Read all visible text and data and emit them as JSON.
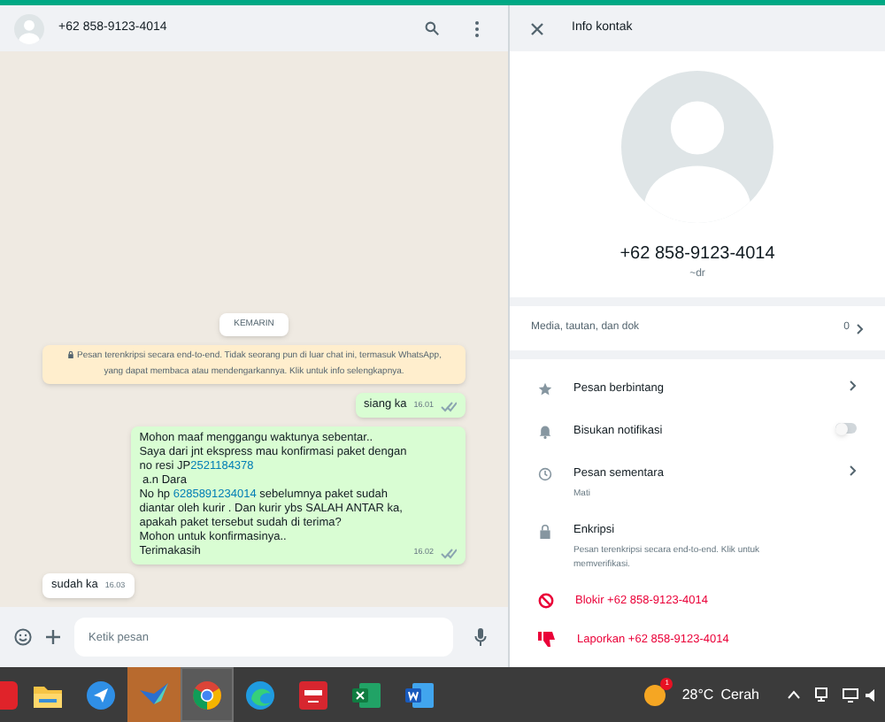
{
  "chat_header": {
    "name": "+62 858-9123-4014"
  },
  "date_chip": "KEMARIN",
  "encryption_notice": "Pesan terenkripsi secara end-to-end. Tidak seorang pun di luar chat ini, termasuk WhatsApp, yang dapat membaca atau mendengarkannya. Klik untuk info selengkapnya.",
  "messages": [
    {
      "outgoing": true,
      "time": "16.01",
      "lines": [
        [
          {
            "text": "siang ka",
            "link": false
          }
        ]
      ]
    },
    {
      "outgoing": true,
      "time": "16.02",
      "lines": [
        [
          {
            "text": "Mohon maaf menggangu waktunya sebentar..",
            "link": false
          }
        ],
        [
          {
            "text": "Saya dari jnt ekspress mau konfirmasi paket dengan",
            "link": false
          }
        ],
        [
          {
            "text": "no resi JP",
            "link": false
          },
          {
            "text": "2521184378",
            "link": true
          }
        ],
        [
          {
            "text": " a.n Dara",
            "link": false
          }
        ],
        [
          {
            "text": "No hp ",
            "link": false
          },
          {
            "text": "6285891234014",
            "link": true
          },
          {
            "text": " sebelumnya paket sudah",
            "link": false
          }
        ],
        [
          {
            "text": "diantar oleh kurir . Dan kurir ybs SALAH ANTAR ka,",
            "link": false
          }
        ],
        [
          {
            "text": "apakah paket tersebut sudah di terima?",
            "link": false
          }
        ],
        [
          {
            "text": "Mohon untuk konfirmasinya..",
            "link": false
          }
        ],
        [
          {
            "text": "Terimakasih",
            "link": false
          }
        ]
      ]
    },
    {
      "outgoing": false,
      "time": "16.03",
      "lines": [
        [
          {
            "text": "sudah ka",
            "link": false
          }
        ]
      ]
    }
  ],
  "composer": {
    "placeholder": "Ketik pesan"
  },
  "info_panel": {
    "title": "Info kontak",
    "phone": "+62 858-9123-4014",
    "about": "~dr",
    "media": {
      "label": "Media, tautan, dan dok",
      "count": "0"
    },
    "items": [
      {
        "kind": "link",
        "label": "Pesan berbintang"
      },
      {
        "kind": "toggle",
        "label": "Bisukan notifikasi",
        "on": false
      },
      {
        "kind": "link",
        "label": "Pesan sementara",
        "sub": "Mati"
      },
      {
        "kind": "info",
        "label": "Enkripsi",
        "sub": "Pesan terenkripsi secara end-to-end. Klik untuk memverifikasi."
      }
    ],
    "actions": [
      {
        "label": "Blokir +62 858-9123-4014"
      },
      {
        "label": "Laporkan +62 858-9123-4014"
      }
    ]
  },
  "taskbar": {
    "apps": [
      {
        "kind": "red",
        "active": false,
        "hover": false
      },
      {
        "kind": "folder",
        "active": false,
        "hover": false
      },
      {
        "kind": "send",
        "active": false,
        "hover": false
      },
      {
        "kind": "bird",
        "active": true,
        "hover": false
      },
      {
        "kind": "chrome",
        "active": false,
        "hover": true
      },
      {
        "kind": "edge",
        "active": false,
        "hover": false
      },
      {
        "kind": "jms",
        "active": false,
        "hover": false
      },
      {
        "kind": "excel",
        "active": false,
        "hover": false
      },
      {
        "kind": "word",
        "active": false,
        "hover": false
      }
    ],
    "weather": {
      "temp": "28°C",
      "condition": "Cerah",
      "badge": "1"
    }
  }
}
